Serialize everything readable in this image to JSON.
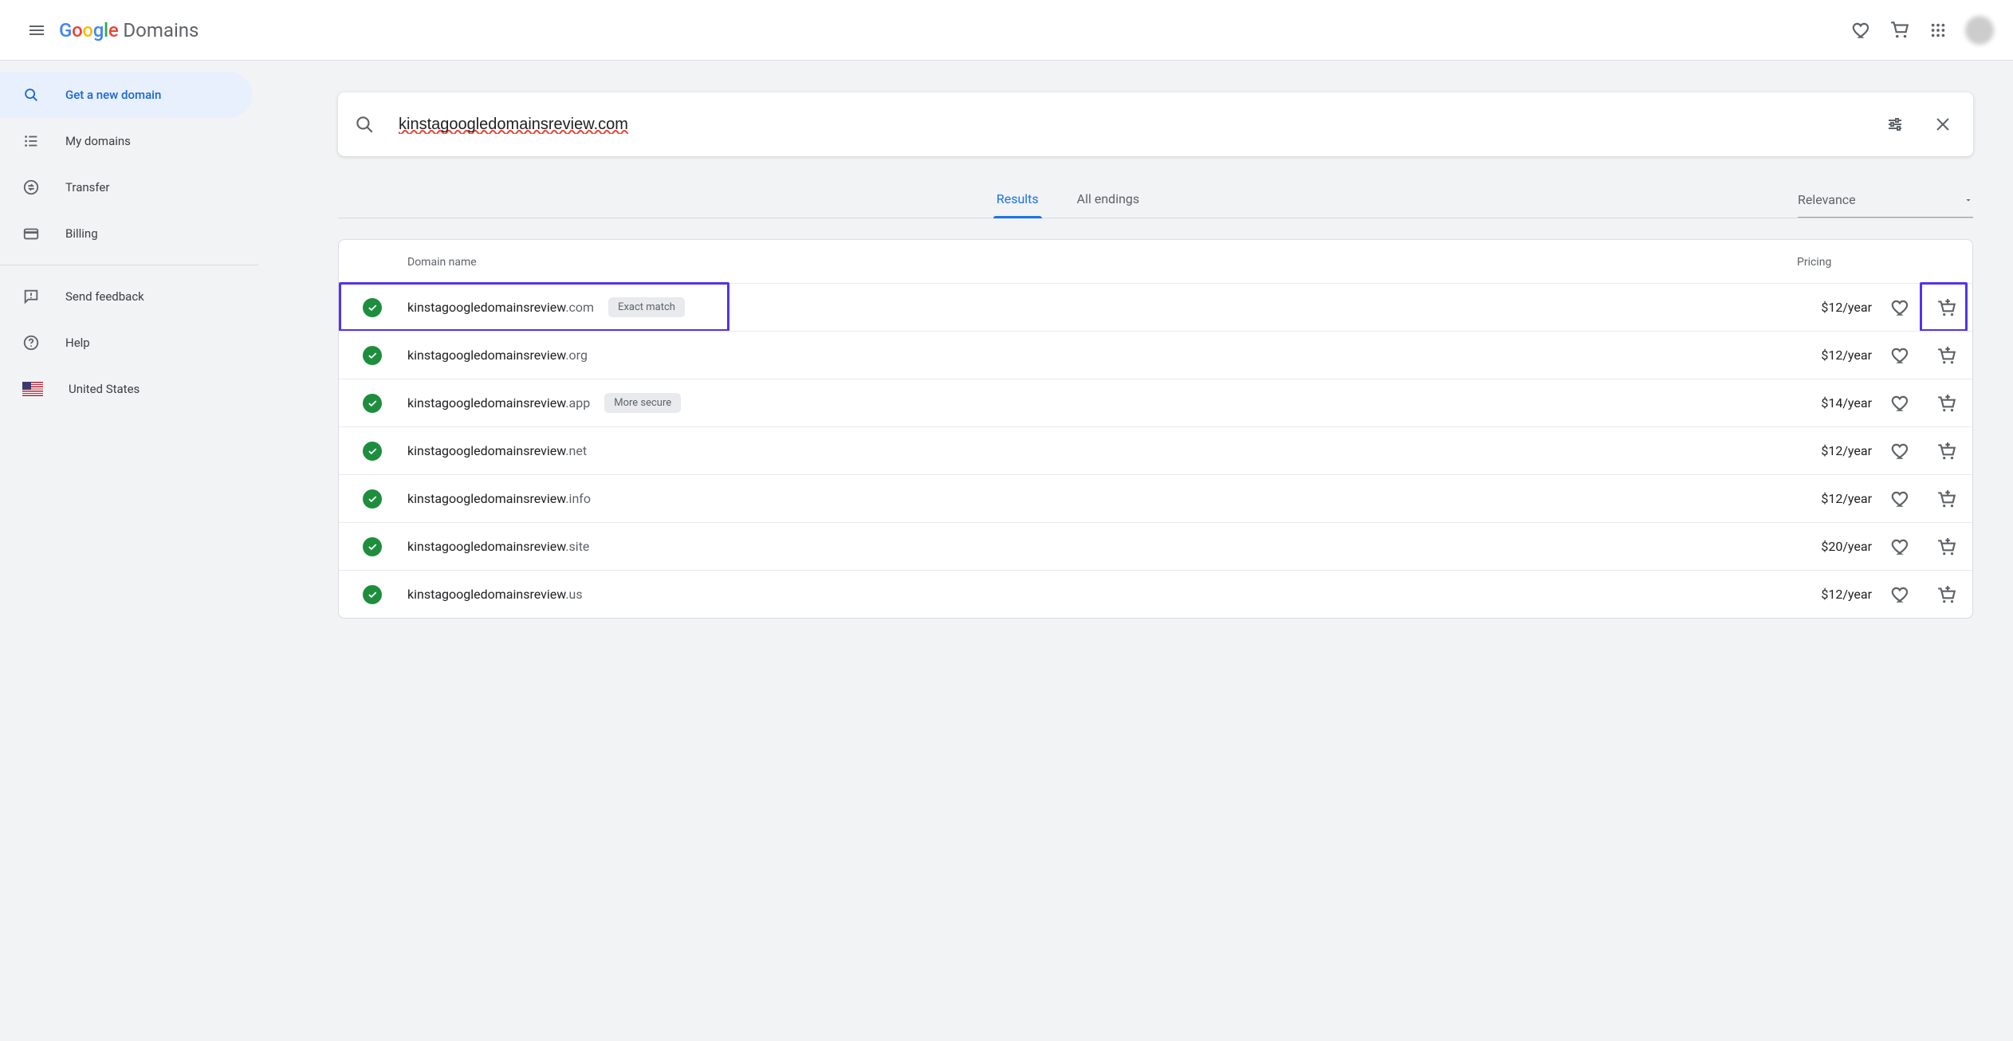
{
  "brand": {
    "google": "Google",
    "product": "Domains"
  },
  "nav": {
    "items": [
      {
        "label": "Get a new domain"
      },
      {
        "label": "My domains"
      },
      {
        "label": "Transfer"
      },
      {
        "label": "Billing"
      },
      {
        "label": "Send feedback"
      },
      {
        "label": "Help"
      },
      {
        "label": "United States"
      }
    ]
  },
  "search": {
    "value": "kinstagoogledomainsreview.com"
  },
  "tabs": {
    "results": "Results",
    "all_endings": "All endings"
  },
  "sort": {
    "label": "Relevance"
  },
  "table": {
    "col_name": "Domain name",
    "col_price": "Pricing"
  },
  "rows": [
    {
      "name": "kinstagoogledomainsreview",
      "ext": ".com",
      "badge": "Exact match",
      "price": "$12/year"
    },
    {
      "name": "kinstagoogledomainsreview",
      "ext": ".org",
      "badge": "",
      "price": "$12/year"
    },
    {
      "name": "kinstagoogledomainsreview",
      "ext": ".app",
      "badge": "More secure",
      "price": "$14/year"
    },
    {
      "name": "kinstagoogledomainsreview",
      "ext": ".net",
      "badge": "",
      "price": "$12/year"
    },
    {
      "name": "kinstagoogledomainsreview",
      "ext": ".info",
      "badge": "",
      "price": "$12/year"
    },
    {
      "name": "kinstagoogledomainsreview",
      "ext": ".site",
      "badge": "",
      "price": "$20/year"
    },
    {
      "name": "kinstagoogledomainsreview",
      "ext": ".us",
      "badge": "",
      "price": "$12/year"
    }
  ]
}
